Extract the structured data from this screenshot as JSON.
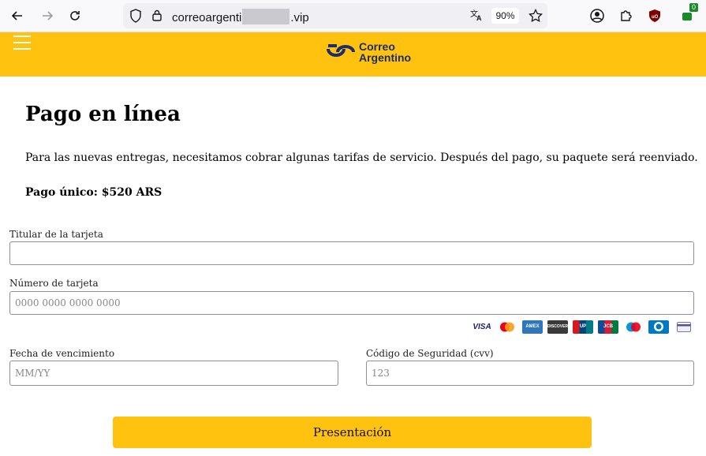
{
  "browser": {
    "url_prefix": "correoargenti",
    "url_suffix": ".vip",
    "zoom": "90%",
    "extension_badge": "0",
    "icons": [
      "back-icon",
      "forward-icon",
      "reload-icon",
      "shield-icon",
      "lock-icon",
      "translate-icon",
      "star-icon",
      "account-icon",
      "extensions-icon",
      "ublock-icon",
      "extension-icon"
    ]
  },
  "header": {
    "brand_line1": "Correo",
    "brand_line2": "Argentino",
    "colors": {
      "background": "#ffc20e",
      "brand": "#1d2c6e"
    }
  },
  "page": {
    "title": "Pago en línea",
    "description": "Para las nuevas entregas, necesitamos cobrar algunas tarifas de servicio. Después del pago, su paquete será reenviado.",
    "price": "Pago único: $520 ARS"
  },
  "form": {
    "holder_label": "Titular de la tarjeta",
    "holder_value": "",
    "card_label": "Número de tarjeta",
    "card_placeholder": "0000 0000 0000 0000",
    "expiry_label": "Fecha de vencimiento",
    "expiry_placeholder": "MM/YY",
    "cvv_label": "Código de Seguridad (cvv)",
    "cvv_placeholder": "123",
    "card_brands": [
      "VISA",
      "MasterCard",
      "American Express",
      "DISCOVER",
      "UnionPay",
      "JCB",
      "Maestro",
      "Diners Club",
      "Generic card"
    ],
    "submit_label": "Presentación"
  }
}
